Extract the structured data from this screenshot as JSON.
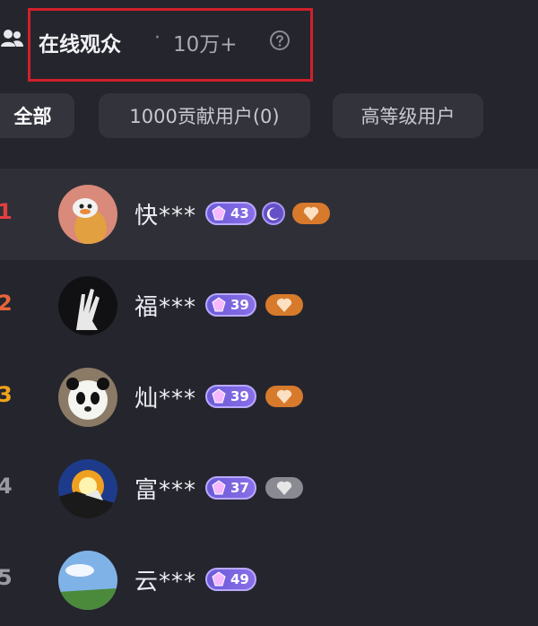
{
  "header": {
    "title": "在线观众",
    "separator": "·",
    "count": "10万+",
    "highlight_color": "#d0202b"
  },
  "tabs": [
    {
      "label": "全部",
      "active": true
    },
    {
      "label": "1000贡献用户(0)",
      "active": false
    },
    {
      "label": "高等级用户",
      "active": false
    }
  ],
  "viewers": [
    {
      "rank": "1",
      "rank_color": "#e33f3f",
      "name": "快***",
      "level": "43",
      "has_moon": true,
      "fan_badge": "orange",
      "avatar": "duck-avatar"
    },
    {
      "rank": "2",
      "rank_color": "#e8643a",
      "name": "福***",
      "level": "39",
      "has_moon": false,
      "fan_badge": "orange",
      "avatar": "dark-hand-avatar"
    },
    {
      "rank": "3",
      "rank_color": "#f0a21c",
      "name": "灿***",
      "level": "39",
      "has_moon": false,
      "fan_badge": "orange",
      "avatar": "panda-avatar"
    },
    {
      "rank": "4",
      "rank_color": "#9a9aa4",
      "name": "富***",
      "level": "37",
      "has_moon": false,
      "fan_badge": "grey",
      "avatar": "sunset-avatar"
    },
    {
      "rank": "5",
      "rank_color": "#9a9aa4",
      "name": "云***",
      "level": "49",
      "has_moon": false,
      "fan_badge": "none",
      "avatar": "sky-avatar"
    }
  ]
}
